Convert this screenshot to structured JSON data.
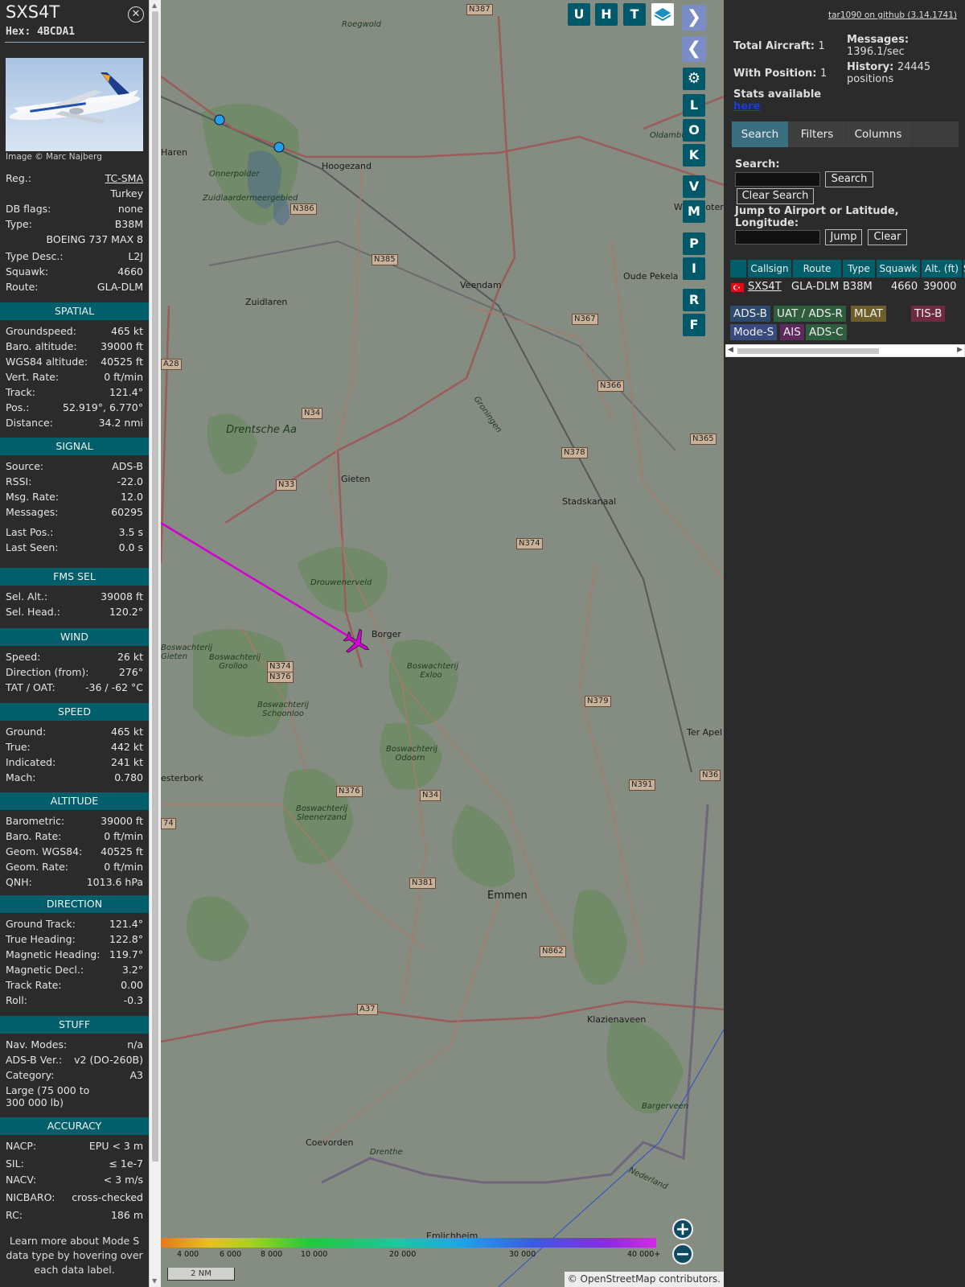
{
  "selected": {
    "callsign": "SXS4T",
    "hex": "Hex: 4BCDA1",
    "close_icon": "close-circle-icon",
    "photo_credit": "Image © Marc Najberg",
    "info": [
      {
        "k": "Reg.:",
        "v": "TC-SMA"
      },
      {
        "k": "",
        "v": "Turkey"
      },
      {
        "k": "DB flags:",
        "v": "none"
      },
      {
        "k": "Type:",
        "v": "B38M"
      },
      {
        "k": "",
        "v": "BOEING 737 MAX 8"
      },
      {
        "k": "Type Desc.:",
        "v": "L2J"
      },
      {
        "k": "Squawk:",
        "v": "4660"
      },
      {
        "k": "Route:",
        "v": "GLA-DLM"
      }
    ]
  },
  "sections": [
    {
      "title": "SPATIAL",
      "rows": [
        {
          "k": "Groundspeed:",
          "v": "465 kt"
        },
        {
          "k": "Baro. altitude:",
          "v": "39000 ft"
        },
        {
          "k": "WGS84 altitude:",
          "v": "40525 ft"
        },
        {
          "k": "Vert. Rate:",
          "v": "0 ft/min"
        },
        {
          "k": "Track:",
          "v": "121.4°"
        },
        {
          "k": "Pos.:",
          "v": "52.919°, 6.770°"
        },
        {
          "k": "Distance:",
          "v": "34.2 nmi"
        }
      ]
    },
    {
      "title": "SIGNAL",
      "rows": [
        {
          "k": "Source:",
          "v": "ADS-B"
        },
        {
          "k": "RSSI:",
          "v": "-22.0"
        },
        {
          "k": "Msg. Rate:",
          "v": "12.0"
        },
        {
          "k": "Messages:",
          "v": "60295"
        },
        {
          "k": "Last Pos.:",
          "v": "3.5 s"
        },
        {
          "k": "Last Seen:",
          "v": "0.0 s"
        }
      ]
    },
    {
      "title": "FMS SEL",
      "rows": [
        {
          "k": "Sel. Alt.:",
          "v": "39008 ft"
        },
        {
          "k": "Sel. Head.:",
          "v": "120.2°"
        }
      ]
    },
    {
      "title": "WIND",
      "rows": [
        {
          "k": "Speed:",
          "v": "26 kt"
        },
        {
          "k": "Direction (from):",
          "v": "276°"
        },
        {
          "k": "TAT / OAT:",
          "v": "-36 / -62 °C"
        }
      ]
    },
    {
      "title": "SPEED",
      "rows": [
        {
          "k": "Ground:",
          "v": "465 kt"
        },
        {
          "k": "True:",
          "v": "442 kt"
        },
        {
          "k": "Indicated:",
          "v": "241 kt"
        },
        {
          "k": "Mach:",
          "v": "0.780"
        }
      ]
    },
    {
      "title": "ALTITUDE",
      "rows": [
        {
          "k": "Barometric:",
          "v": "39000 ft"
        },
        {
          "k": "Baro. Rate:",
          "v": "0 ft/min"
        },
        {
          "k": "Geom. WGS84:",
          "v": "40525 ft"
        },
        {
          "k": "Geom. Rate:",
          "v": "0 ft/min"
        },
        {
          "k": "QNH:",
          "v": "1013.6 hPa"
        }
      ]
    },
    {
      "title": "DIRECTION",
      "rows": [
        {
          "k": "Ground Track:",
          "v": "121.4°"
        },
        {
          "k": "True Heading:",
          "v": "122.8°"
        },
        {
          "k": "Magnetic Heading:",
          "v": "119.7°"
        },
        {
          "k": "Magnetic Decl.:",
          "v": "3.2°"
        },
        {
          "k": "Track Rate:",
          "v": "0.00"
        },
        {
          "k": "Roll:",
          "v": "-0.3"
        }
      ]
    },
    {
      "title": "STUFF",
      "rows": [
        {
          "k": "Nav. Modes:",
          "v": "n/a"
        },
        {
          "k": "ADS-B Ver.:",
          "v": "v2 (DO-260B)"
        },
        {
          "k": "Category:",
          "v": "A3"
        },
        {
          "k": "Large (75 000 to 300 000 lb)",
          "v": ""
        }
      ]
    },
    {
      "title": "ACCURACY",
      "rows": [
        {
          "k": "NACP:",
          "v": "EPU < 3 m"
        },
        {
          "k": "SIL:",
          "v": "≤ 1e-7"
        },
        {
          "k": "NACV:",
          "v": "< 3 m/s"
        },
        {
          "k": "NICBARO:",
          "v": "cross-checked"
        },
        {
          "k": "RC:",
          "v": "186 m"
        }
      ]
    }
  ],
  "footer_note": "Learn more about Mode S data type by hovering over each data label.",
  "map": {
    "buttons": [
      "U",
      "H",
      "T"
    ],
    "side_buttons": [
      "L",
      "O",
      "K",
      "V",
      "M",
      "P",
      "I",
      "R",
      "F"
    ],
    "places": [
      "Hoogezand",
      "Veendam",
      "Oude Pekela",
      "Winschoter",
      "Zuidlaren",
      "Drentsche Aa",
      "Gieten",
      "Stadskanaal",
      "Borger",
      "Emmen",
      "Klazienaveen",
      "Coevorden",
      "Ter Apel",
      "Haren",
      "Onnerpolder",
      "Zuidlaardermeergebied",
      "Oldambtmeer",
      "Roegwold",
      "Drouwenerveld",
      "Boswachterij Grolloo",
      "Boswachterij Schoonloo",
      "Boswachterij Exloo",
      "Boswachterij Odoorn",
      "Boswachterij Sleenerzand",
      "Boswachterij Gieten",
      "Bargerveen",
      "Emlichheim",
      "esterbork",
      "Drenthe",
      "Nederland",
      "Groningen"
    ],
    "roads": [
      "N387",
      "N386",
      "N385",
      "N367",
      "N366",
      "N34",
      "N33",
      "N378",
      "N374",
      "N374",
      "N376",
      "N379",
      "N391",
      "N376",
      "N381",
      "N862",
      "A37",
      "A28",
      "N365",
      "N34",
      "N36",
      "74"
    ],
    "altitude_ticks": [
      "4 000",
      "6 000",
      "8 000",
      "10 000",
      "20 000",
      "30 000",
      "40 000+"
    ],
    "scale": "2 NM",
    "attribution": "© OpenStreetMap contributors.",
    "track_color": "#d400d4"
  },
  "panel": {
    "github": "tar1090 on github (3.14.1741)",
    "total_aircraft_label": "Total Aircraft:",
    "total_aircraft": "1",
    "messages_label": "Messages:",
    "messages": "1396.1/sec",
    "with_position_label": "With Position:",
    "with_position": "1",
    "history_label": "History:",
    "history": "24445 positions",
    "stats_label": "Stats available",
    "stats_link": "here",
    "tabs": [
      "Search",
      "Filters",
      "Columns"
    ],
    "search_label": "Search:",
    "search_btn": "Search",
    "clear_search_btn": "Clear Search",
    "jump_label": "Jump to Airport or Latitude, Longitude:",
    "jump_btn": "Jump",
    "clear_btn": "Clear",
    "columns": [
      "Callsign",
      "Route",
      "Type",
      "Squawk",
      "Alt. (ft)",
      "S"
    ],
    "rows": [
      {
        "callsign": "SXS4T",
        "route": "GLA-DLM",
        "type": "B38M",
        "squawk": "4660",
        "alt": "39000"
      }
    ],
    "legend": [
      {
        "label": "ADS-B",
        "color": "#2d4a6e"
      },
      {
        "label": "UAT / ADS-R",
        "color": "#2e5e3e"
      },
      {
        "label": "MLAT",
        "color": "#6e5e2a"
      },
      {
        "label": "TIS-B",
        "color": "#6e2a3e"
      },
      {
        "label": "Mode-S",
        "color": "#3a4a7e"
      },
      {
        "label": "AIS",
        "color": "#5e2a5e"
      },
      {
        "label": "ADS-C",
        "color": "#2e5e3e"
      }
    ]
  }
}
